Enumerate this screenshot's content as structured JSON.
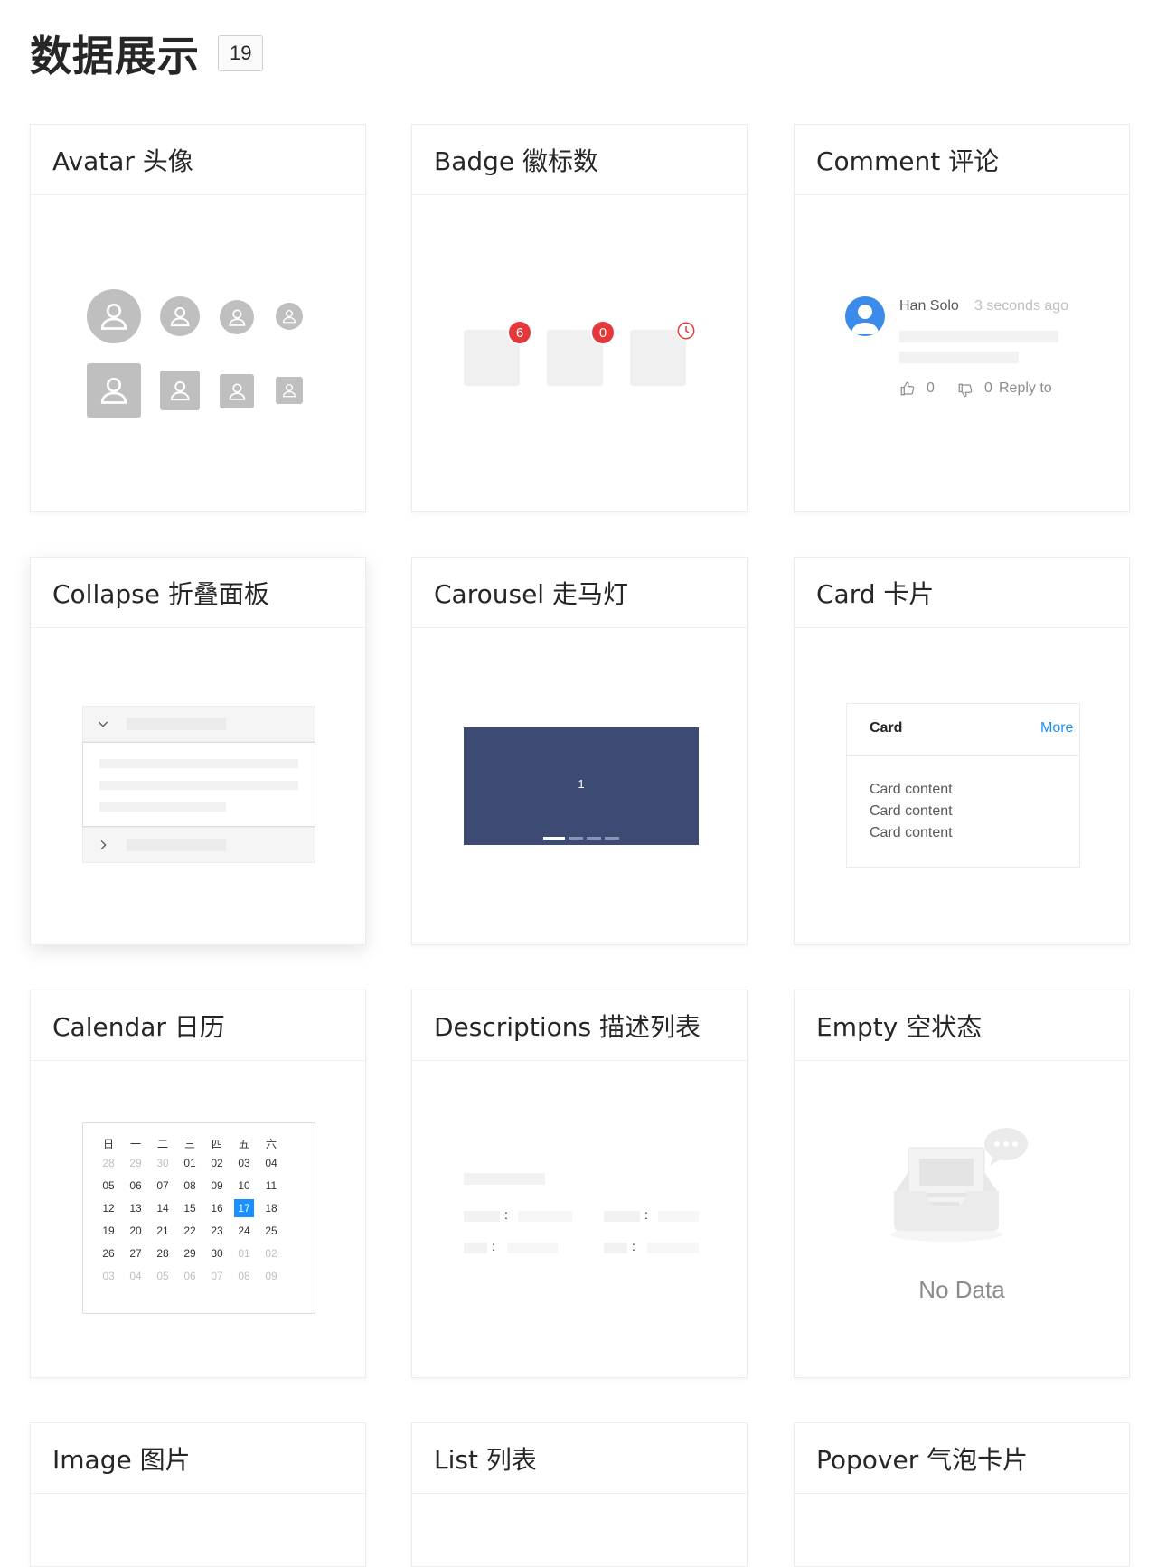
{
  "header": {
    "title": "数据展示",
    "count": "19"
  },
  "cards": {
    "avatar": {
      "title": "Avatar 头像"
    },
    "badge": {
      "title": "Badge 徽标数",
      "counts": [
        "6",
        "0"
      ]
    },
    "comment": {
      "title": "Comment 评论",
      "author": "Han Solo",
      "time": "3 seconds ago",
      "likes": "0",
      "dislikes": "0",
      "reply": "Reply to"
    },
    "collapse": {
      "title": "Collapse 折叠面板"
    },
    "carousel": {
      "title": "Carousel 走马灯",
      "slide": "1",
      "bg_color": "#3d4a73"
    },
    "card": {
      "title": "Card 卡片",
      "inner_title": "Card",
      "more": "More",
      "lines": [
        "Card content",
        "Card content",
        "Card content"
      ]
    },
    "calendar": {
      "title": "Calendar 日历",
      "weekdays": [
        "日",
        "一",
        "二",
        "三",
        "四",
        "五",
        "六"
      ],
      "days": [
        "28",
        "29",
        "30",
        "01",
        "02",
        "03",
        "04",
        "05",
        "06",
        "07",
        "08",
        "09",
        "10",
        "11",
        "12",
        "13",
        "14",
        "15",
        "16",
        "17",
        "18",
        "19",
        "20",
        "21",
        "22",
        "23",
        "24",
        "25",
        "26",
        "27",
        "28",
        "29",
        "30",
        "01",
        "02",
        "03",
        "04",
        "05",
        "06",
        "07",
        "08",
        "09"
      ],
      "dim_days": [
        0,
        1,
        2,
        33,
        34,
        35,
        36,
        37,
        38,
        39,
        40,
        41
      ],
      "selected": 19
    },
    "descriptions": {
      "title": "Descriptions 描述列表"
    },
    "empty": {
      "title": "Empty 空状态",
      "text": "No Data"
    },
    "image": {
      "title": "Image 图片"
    },
    "list": {
      "title": "List 列表"
    },
    "popover": {
      "title": "Popover 气泡卡片"
    }
  }
}
